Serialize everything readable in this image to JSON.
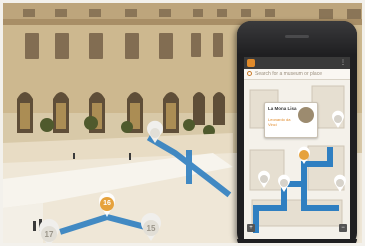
{
  "colors": {
    "route": "#2f7fc1",
    "pin_orange": "#e6a23c",
    "pin_gray": "#f0efec",
    "phone_body": "#1f1f21",
    "map_floor": "#f4f1ea"
  },
  "icons": {
    "app": "app-logo-icon",
    "overflow": "overflow-menu-icon",
    "search": "search-icon",
    "pin": "location-pin-icon"
  },
  "phone": {
    "search_placeholder": "Search for a museum or place",
    "poi": {
      "title": "La Mona Lisa",
      "subtitle": "Leonardo da Vinci"
    },
    "controls": {
      "zoom_in": "+",
      "zoom_out": "−"
    }
  },
  "scene": {
    "pins": [
      {
        "label": "16",
        "style": "orange"
      },
      {
        "label": "17",
        "style": "gray"
      },
      {
        "label": "15",
        "style": "gray"
      }
    ]
  }
}
